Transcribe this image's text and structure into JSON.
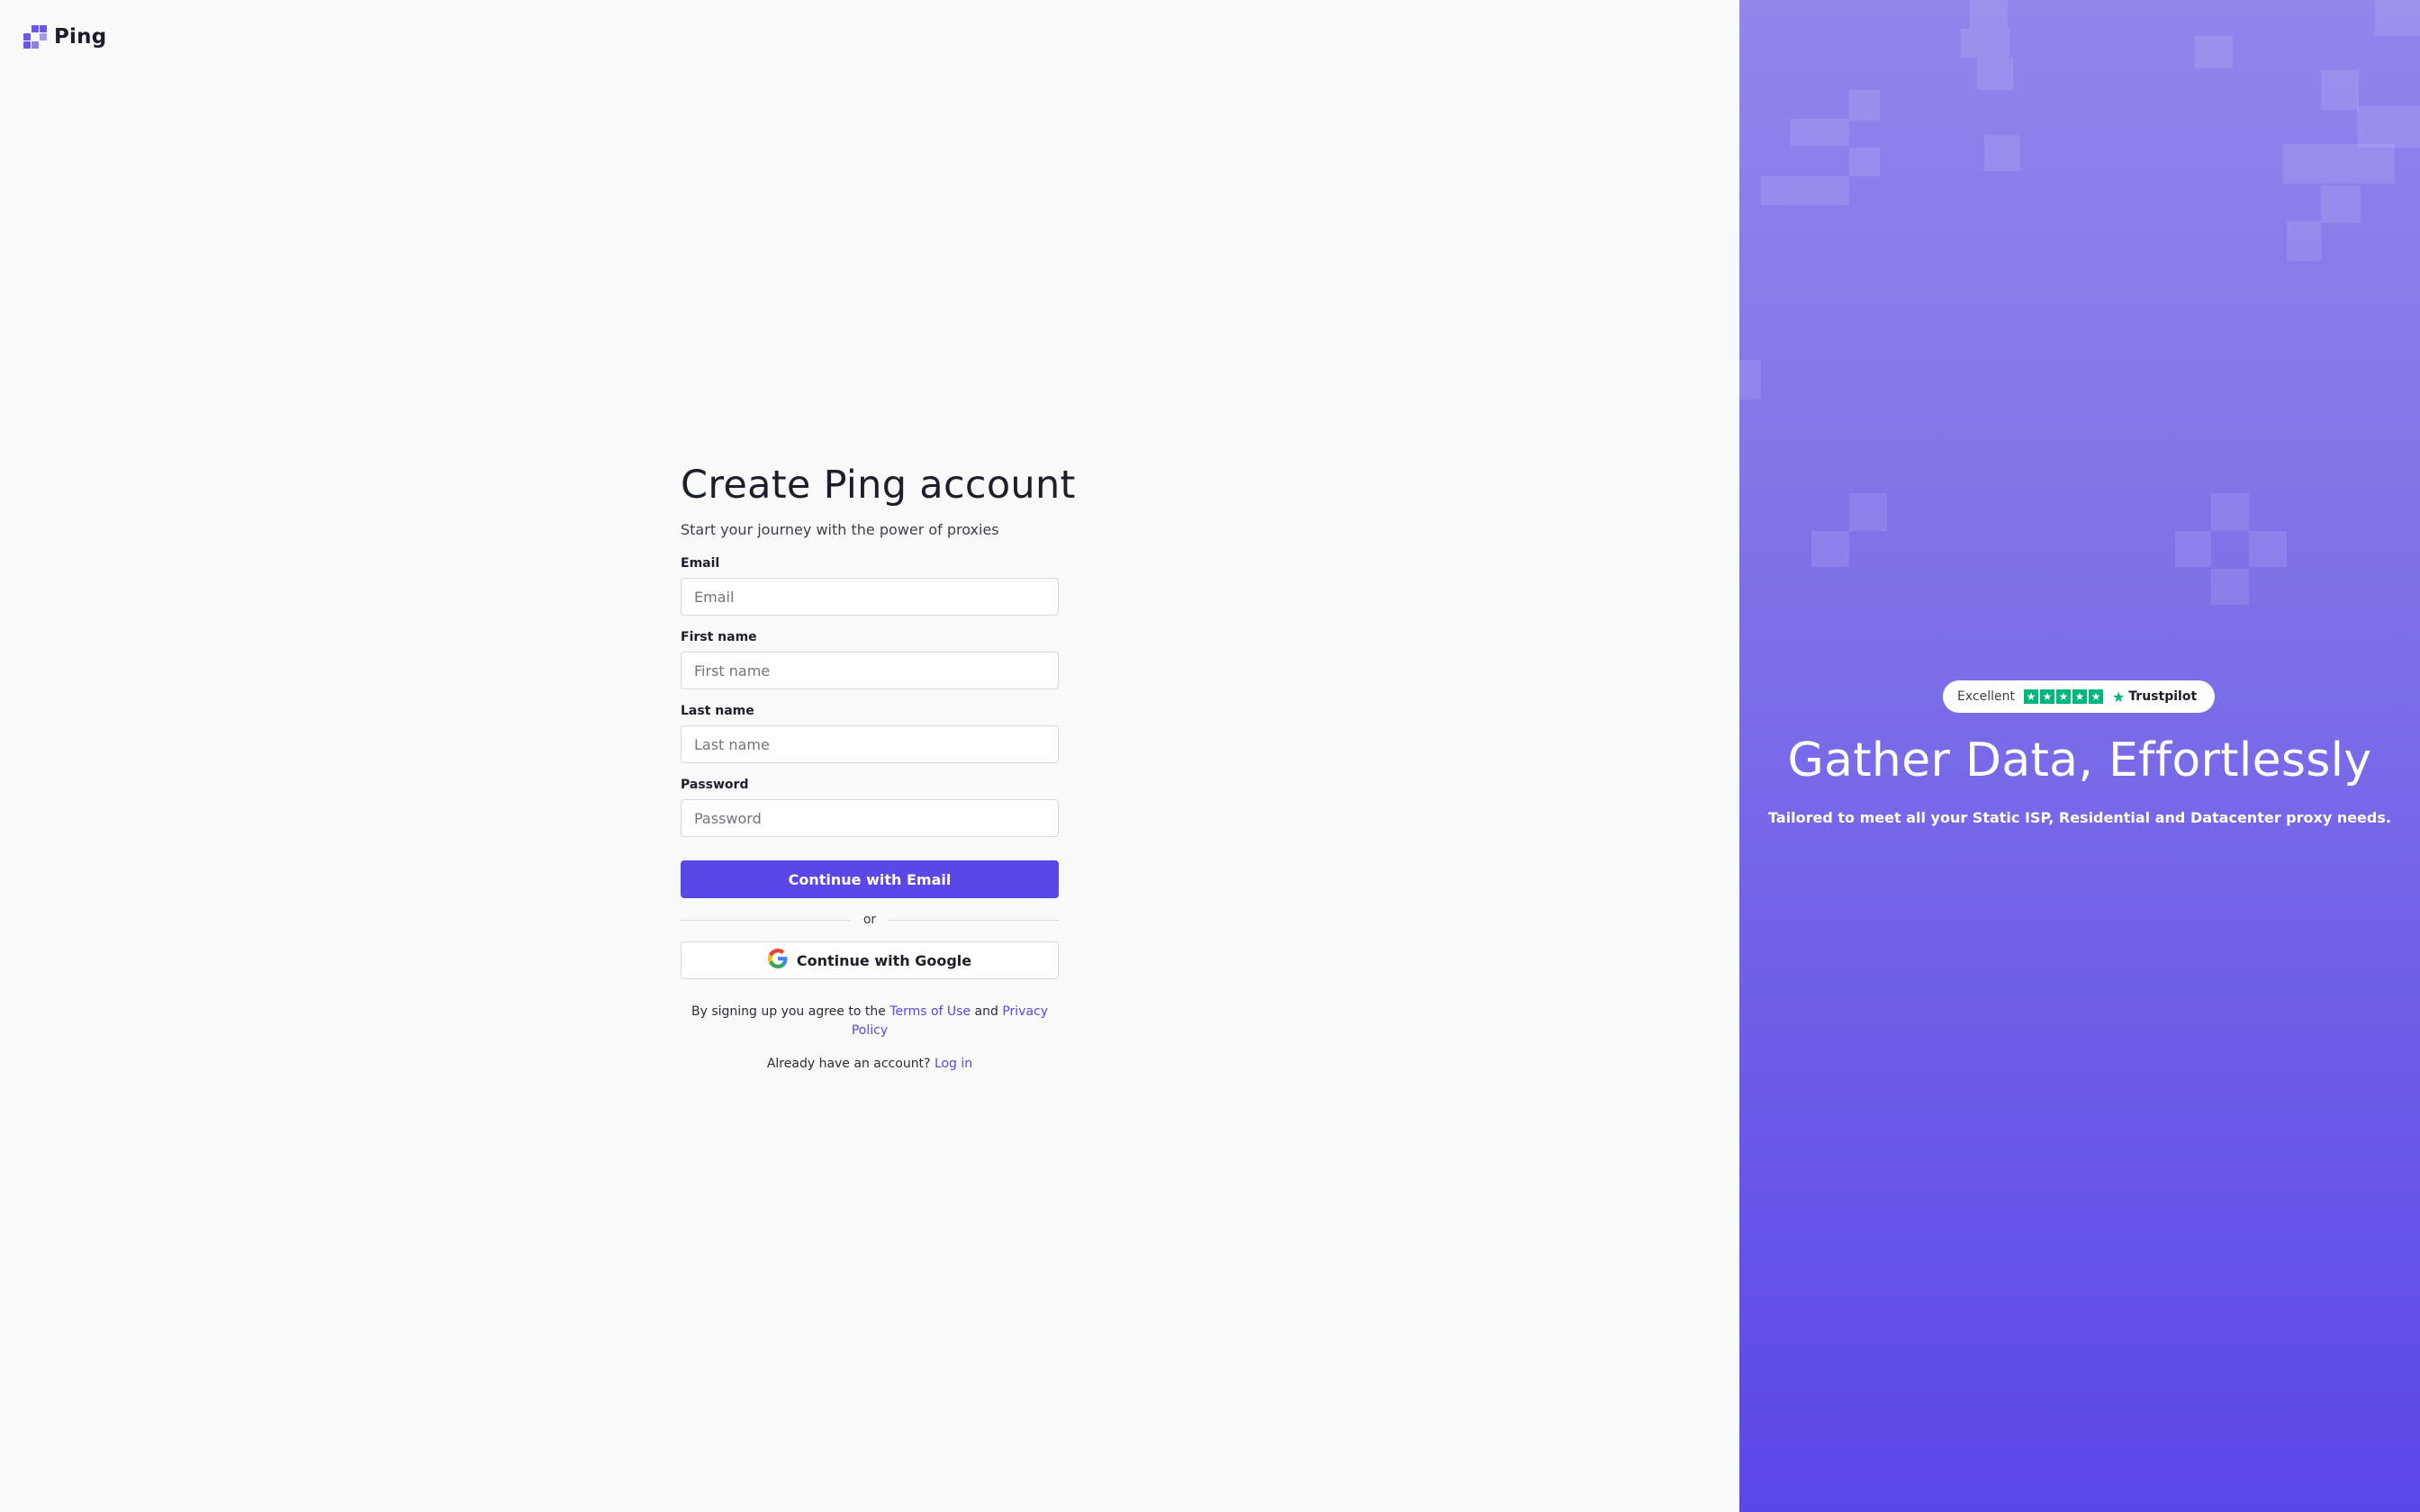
{
  "brand": {
    "name": "Ping",
    "accent": "#5a47e8",
    "logo_icon": "ping-logo-icon"
  },
  "signup": {
    "title": "Create Ping account",
    "subtitle": "Start your journey with the power of proxies",
    "fields": [
      {
        "label": "Email",
        "placeholder": "Email",
        "value": ""
      },
      {
        "label": "First name",
        "placeholder": "First name",
        "value": ""
      },
      {
        "label": "Last name",
        "placeholder": "Last name",
        "value": ""
      },
      {
        "label": "Password",
        "placeholder": "Password",
        "value": ""
      }
    ],
    "continue_email": "Continue with Email",
    "divider_text": "or",
    "continue_google": "Continue with Google",
    "google_icon": "google-icon",
    "terms_prefix": "By signing up you agree to the",
    "terms_link": "Terms of Use",
    "terms_and": "and",
    "privacy_link": "Privacy Policy",
    "login_prompt": "Already have an account?",
    "login_link": "Log in"
  },
  "promo": {
    "rating_label": "Excellent",
    "rating_stars": 5,
    "rating_brand": "Trustpilot",
    "rating_color": "#00b67a",
    "headline": "Gather Data, Effortlessly",
    "description": "Tailored to meet all your Static ISP, Residential and Datacenter proxy needs.",
    "gradient_top": "#9186ea",
    "gradient_bottom": "#5a47e8"
  }
}
